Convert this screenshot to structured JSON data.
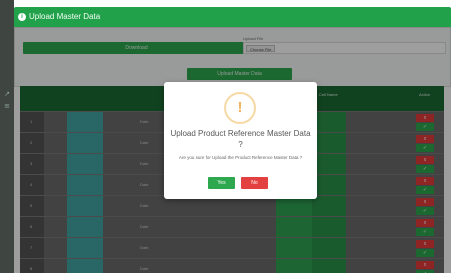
{
  "header": {
    "title": "Upload Master Data",
    "icon": "info-icon"
  },
  "form": {
    "download_label": "",
    "download_button": "Download",
    "file_label": "Upload File",
    "file_choose": "Choose File",
    "file_name": "",
    "upload_button": "Upload Master Data"
  },
  "table": {
    "headers": [
      "",
      "",
      "",
      "",
      "",
      "",
      "",
      "",
      "",
      "Cell Name",
      "",
      "",
      "Action"
    ],
    "rows": [
      {
        "idx": "1",
        "teal": "",
        "c1": "",
        "c2": "Date",
        "c3": "",
        "c4": "",
        "c5": "",
        "g1": "",
        "g2": ""
      },
      {
        "idx": "2",
        "teal": "",
        "c1": "",
        "c2": "Date",
        "c3": "",
        "c4": "",
        "c5": "",
        "g1": "",
        "g2": ""
      },
      {
        "idx": "3",
        "teal": "",
        "c1": "",
        "c2": "Date",
        "c3": "",
        "c4": "",
        "c5": "",
        "g1": "",
        "g2": ""
      },
      {
        "idx": "4",
        "teal": "",
        "c1": "",
        "c2": "Date",
        "c3": "",
        "c4": "",
        "c5": "",
        "g1": "",
        "g2": ""
      },
      {
        "idx": "5",
        "teal": "",
        "c1": "",
        "c2": "Date",
        "c3": "",
        "c4": "",
        "c5": "",
        "g1": "",
        "g2": ""
      },
      {
        "idx": "6",
        "teal": "",
        "c1": "",
        "c2": "Date",
        "c3": "",
        "c4": "",
        "c5": "",
        "g1": "",
        "g2": ""
      },
      {
        "idx": "7",
        "teal": "",
        "c1": "",
        "c2": "Date",
        "c3": "",
        "c4": "",
        "c5": "",
        "g1": "",
        "g2": ""
      },
      {
        "idx": "8",
        "teal": "",
        "c1": "",
        "c2": "Date",
        "c3": "",
        "c4": "",
        "c5": "",
        "g1": "",
        "g2": ""
      }
    ],
    "delete_icon": "x",
    "edit_icon": "✓"
  },
  "modal": {
    "icon": "!",
    "title": "Upload Product Reference Master Data ?",
    "text": "Are you sure for Upload the Product Reference Master Data ?",
    "yes": "Yes",
    "no": "No"
  },
  "colors": {
    "header": "#20a14a",
    "button_green": "#2ea84f",
    "button_red": "#e34141",
    "warning": "#f0b35c"
  }
}
